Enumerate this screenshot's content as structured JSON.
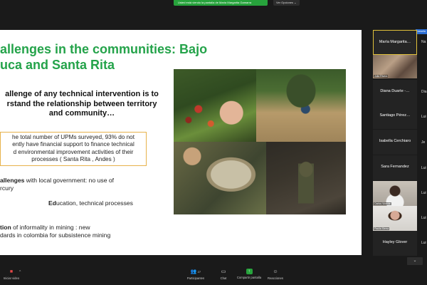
{
  "banner": {
    "sharing_text": "Usted está viendo la pantalla de María Margarita Gamarra",
    "view_options": "Ver Opciones",
    "view_options_caret": "⌄"
  },
  "slide": {
    "title_line1": "allenges in the communities: Bajo",
    "title_line2": "uca and Santa Rita",
    "subtitle_line1": "allenge of any technical intervention is to",
    "subtitle_line2": "rstand the relationship between territory",
    "subtitle_line3": "and community…",
    "box_line1": "he total number of UPMs surveyed, 93% do not",
    "box_line2": "ently have financial support to finance technical",
    "box_line3": "d environmental improvement activities of their",
    "box_line4": "processes ( Santa Rita , Andes )",
    "bullet1_bold": "allenges",
    "bullet1_rest": " with local government: no use of",
    "bullet1_line2": "rcury",
    "bullet2_bold": "Ed",
    "bullet2_rest": "ucation, technical processes",
    "bullet3_bold": "tion",
    "bullet3_rest": " of informality in mining : new",
    "bullet3_line2": "dards in colombia for subsistence mining"
  },
  "participants": {
    "tiles": [
      {
        "name": "María   Margarita…",
        "active": true
      },
      {
        "name": "",
        "label": "Julia Rivera"
      },
      {
        "name": "Diana   Duarte -…"
      },
      {
        "name": "Santiago   Pérez…"
      },
      {
        "name": "Isabella Cerchiaro"
      },
      {
        "name": "Sara Fernandez"
      },
      {
        "name": "",
        "label": "Carlos Vicente"
      },
      {
        "name": "",
        "label": "Paulia Sierra"
      },
      {
        "name": "Hayley Glover"
      }
    ],
    "edge_names": [
      "Na",
      "Dia",
      "Lui",
      "Je",
      "Lui",
      "Lui",
      "Lui",
      "Lui",
      "Lui"
    ],
    "edge_tab": "Cancela",
    "scroll_label": "⌄"
  },
  "toolbar": {
    "video_label": "Iniciar video",
    "participants_label": "Participantes",
    "participants_count": "27",
    "chat_label": "Chat",
    "share_label": "Compartir pantalla",
    "reactions_label": "Reacciones"
  }
}
